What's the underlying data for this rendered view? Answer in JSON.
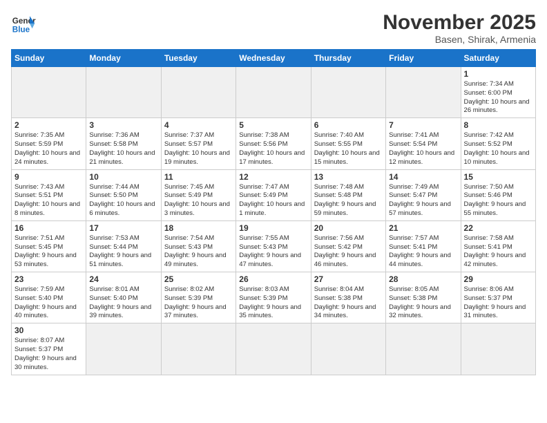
{
  "logo": {
    "line1": "General",
    "line2": "Blue"
  },
  "title": "November 2025",
  "subtitle": "Basen, Shirak, Armenia",
  "weekdays": [
    "Sunday",
    "Monday",
    "Tuesday",
    "Wednesday",
    "Thursday",
    "Friday",
    "Saturday"
  ],
  "weeks": [
    [
      {
        "day": "",
        "info": ""
      },
      {
        "day": "",
        "info": ""
      },
      {
        "day": "",
        "info": ""
      },
      {
        "day": "",
        "info": ""
      },
      {
        "day": "",
        "info": ""
      },
      {
        "day": "",
        "info": ""
      },
      {
        "day": "1",
        "info": "Sunrise: 7:34 AM\nSunset: 6:00 PM\nDaylight: 10 hours\nand 26 minutes."
      }
    ],
    [
      {
        "day": "2",
        "info": "Sunrise: 7:35 AM\nSunset: 5:59 PM\nDaylight: 10 hours\nand 24 minutes."
      },
      {
        "day": "3",
        "info": "Sunrise: 7:36 AM\nSunset: 5:58 PM\nDaylight: 10 hours\nand 21 minutes."
      },
      {
        "day": "4",
        "info": "Sunrise: 7:37 AM\nSunset: 5:57 PM\nDaylight: 10 hours\nand 19 minutes."
      },
      {
        "day": "5",
        "info": "Sunrise: 7:38 AM\nSunset: 5:56 PM\nDaylight: 10 hours\nand 17 minutes."
      },
      {
        "day": "6",
        "info": "Sunrise: 7:40 AM\nSunset: 5:55 PM\nDaylight: 10 hours\nand 15 minutes."
      },
      {
        "day": "7",
        "info": "Sunrise: 7:41 AM\nSunset: 5:54 PM\nDaylight: 10 hours\nand 12 minutes."
      },
      {
        "day": "8",
        "info": "Sunrise: 7:42 AM\nSunset: 5:52 PM\nDaylight: 10 hours\nand 10 minutes."
      }
    ],
    [
      {
        "day": "9",
        "info": "Sunrise: 7:43 AM\nSunset: 5:51 PM\nDaylight: 10 hours\nand 8 minutes."
      },
      {
        "day": "10",
        "info": "Sunrise: 7:44 AM\nSunset: 5:50 PM\nDaylight: 10 hours\nand 6 minutes."
      },
      {
        "day": "11",
        "info": "Sunrise: 7:45 AM\nSunset: 5:49 PM\nDaylight: 10 hours\nand 3 minutes."
      },
      {
        "day": "12",
        "info": "Sunrise: 7:47 AM\nSunset: 5:49 PM\nDaylight: 10 hours\nand 1 minute."
      },
      {
        "day": "13",
        "info": "Sunrise: 7:48 AM\nSunset: 5:48 PM\nDaylight: 9 hours\nand 59 minutes."
      },
      {
        "day": "14",
        "info": "Sunrise: 7:49 AM\nSunset: 5:47 PM\nDaylight: 9 hours\nand 57 minutes."
      },
      {
        "day": "15",
        "info": "Sunrise: 7:50 AM\nSunset: 5:46 PM\nDaylight: 9 hours\nand 55 minutes."
      }
    ],
    [
      {
        "day": "16",
        "info": "Sunrise: 7:51 AM\nSunset: 5:45 PM\nDaylight: 9 hours\nand 53 minutes."
      },
      {
        "day": "17",
        "info": "Sunrise: 7:53 AM\nSunset: 5:44 PM\nDaylight: 9 hours\nand 51 minutes."
      },
      {
        "day": "18",
        "info": "Sunrise: 7:54 AM\nSunset: 5:43 PM\nDaylight: 9 hours\nand 49 minutes."
      },
      {
        "day": "19",
        "info": "Sunrise: 7:55 AM\nSunset: 5:43 PM\nDaylight: 9 hours\nand 47 minutes."
      },
      {
        "day": "20",
        "info": "Sunrise: 7:56 AM\nSunset: 5:42 PM\nDaylight: 9 hours\nand 46 minutes."
      },
      {
        "day": "21",
        "info": "Sunrise: 7:57 AM\nSunset: 5:41 PM\nDaylight: 9 hours\nand 44 minutes."
      },
      {
        "day": "22",
        "info": "Sunrise: 7:58 AM\nSunset: 5:41 PM\nDaylight: 9 hours\nand 42 minutes."
      }
    ],
    [
      {
        "day": "23",
        "info": "Sunrise: 7:59 AM\nSunset: 5:40 PM\nDaylight: 9 hours\nand 40 minutes."
      },
      {
        "day": "24",
        "info": "Sunrise: 8:01 AM\nSunset: 5:40 PM\nDaylight: 9 hours\nand 39 minutes."
      },
      {
        "day": "25",
        "info": "Sunrise: 8:02 AM\nSunset: 5:39 PM\nDaylight: 9 hours\nand 37 minutes."
      },
      {
        "day": "26",
        "info": "Sunrise: 8:03 AM\nSunset: 5:39 PM\nDaylight: 9 hours\nand 35 minutes."
      },
      {
        "day": "27",
        "info": "Sunrise: 8:04 AM\nSunset: 5:38 PM\nDaylight: 9 hours\nand 34 minutes."
      },
      {
        "day": "28",
        "info": "Sunrise: 8:05 AM\nSunset: 5:38 PM\nDaylight: 9 hours\nand 32 minutes."
      },
      {
        "day": "29",
        "info": "Sunrise: 8:06 AM\nSunset: 5:37 PM\nDaylight: 9 hours\nand 31 minutes."
      }
    ],
    [
      {
        "day": "30",
        "info": "Sunrise: 8:07 AM\nSunset: 5:37 PM\nDaylight: 9 hours\nand 30 minutes."
      },
      {
        "day": "",
        "info": ""
      },
      {
        "day": "",
        "info": ""
      },
      {
        "day": "",
        "info": ""
      },
      {
        "day": "",
        "info": ""
      },
      {
        "day": "",
        "info": ""
      },
      {
        "day": "",
        "info": ""
      }
    ]
  ]
}
